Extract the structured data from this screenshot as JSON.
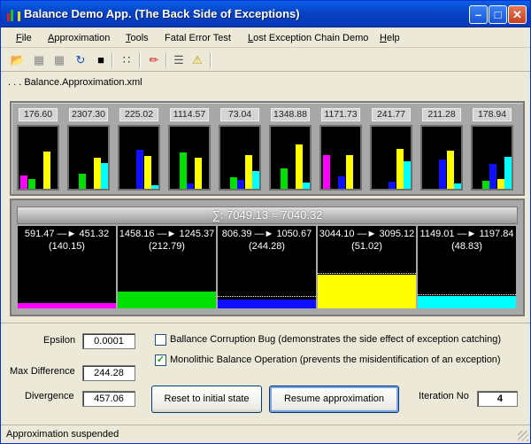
{
  "window": {
    "title": "Balance Demo App.  (The Back Side of Exceptions)"
  },
  "menu": [
    {
      "label": "File",
      "key": "F"
    },
    {
      "label": "Approximation",
      "key": "A"
    },
    {
      "label": "Tools",
      "key": "T"
    },
    {
      "label": "Fatal Error Test",
      "key": ""
    },
    {
      "label": "Lost Exception Chain Demo",
      "key": "L"
    },
    {
      "label": "Help",
      "key": "H"
    }
  ],
  "toolbar": {
    "icons": [
      "open-folder-icon",
      "save-icon",
      "save-as-icon",
      "refresh-icon",
      "stop-icon",
      "grid-icon",
      "pencil-icon",
      "document-icon",
      "warning-icon"
    ]
  },
  "file_path": ". . .  Balance.Approximation.xml",
  "colors": {
    "magenta": "#ff00ff",
    "green": "#00e000",
    "blue": "#1010ff",
    "yellow": "#ffff00",
    "cyan": "#00ffff"
  },
  "columns": [
    {
      "value": "176.60",
      "bars": [
        0.22,
        0.16,
        0.0,
        0.6,
        0.0
      ]
    },
    {
      "value": "2307.30",
      "bars": [
        0.0,
        0.25,
        0.0,
        0.5,
        0.42
      ]
    },
    {
      "value": "225.02",
      "bars": [
        0.0,
        0.0,
        0.63,
        0.53,
        0.06
      ]
    },
    {
      "value": "1114.57",
      "bars": [
        0.0,
        0.59,
        0.09,
        0.5,
        0.0
      ]
    },
    {
      "value": "73.04",
      "bars": [
        0.0,
        0.19,
        0.15,
        0.55,
        0.29
      ]
    },
    {
      "value": "1348.88",
      "bars": [
        0.0,
        0.33,
        0.0,
        0.72,
        0.1
      ]
    },
    {
      "value": "1171.73",
      "bars": [
        0.55,
        0.0,
        0.2,
        0.55,
        0.0
      ]
    },
    {
      "value": "241.77",
      "bars": [
        0.0,
        0.0,
        0.11,
        0.64,
        0.45
      ]
    },
    {
      "value": "211.28",
      "bars": [
        0.0,
        0.0,
        0.47,
        0.62,
        0.08
      ]
    },
    {
      "value": "178.94",
      "bars": [
        0.0,
        0.13,
        0.4,
        0.16,
        0.52
      ]
    }
  ],
  "sum_label": "∑: 7049.13 ≈ 7040.32",
  "cells": [
    {
      "line1": "591.47 —► 451.32",
      "line2": "(140.15)",
      "color": "magenta",
      "fill": 0.07,
      "dots": 0.0
    },
    {
      "line1": "1458.16 —► 1245.37",
      "line2": "(212.79)",
      "color": "green",
      "fill": 0.2,
      "dots": 0.0
    },
    {
      "line1": "806.39 —► 1050.67",
      "line2": "(244.28)",
      "color": "blue",
      "fill": 0.11,
      "dots": 0.14
    },
    {
      "line1": "3044.10 —► 3095.12",
      "line2": "(51.02)",
      "color": "yellow",
      "fill": 0.41,
      "dots": 0.42
    },
    {
      "line1": "1149.01 —► 1197.84",
      "line2": "(48.83)",
      "color": "cyan",
      "fill": 0.15,
      "dots": 0.16
    }
  ],
  "controls": {
    "epsilon_label": "Epsilon",
    "epsilon_value": "0.0001",
    "max_diff_label": "Max Difference",
    "max_diff_value": "244.28",
    "divergence_label": "Divergence",
    "divergence_value": "457.06",
    "corruption_label": "Ballance Corruption Bug (demonstrates the side effect of exception catching)",
    "corruption_checked": false,
    "monolithic_label": "Monolithic Balance Operation (prevents the misidentification of an exception)",
    "monolithic_checked": true,
    "reset_label": "Reset to initial state",
    "resume_label": "Resume approximation",
    "iteration_label": "Iteration No",
    "iteration_value": "4"
  },
  "status": "Approximation suspended"
}
